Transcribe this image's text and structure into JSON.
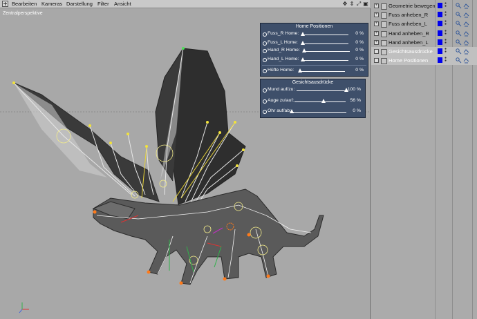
{
  "menubar": {
    "items": [
      "Bearbeiten",
      "Kameras",
      "Darstellung",
      "Filter",
      "Ansicht"
    ]
  },
  "nav_icons": [
    "move-view-icon",
    "scroll-view-icon",
    "zoom-view-icon",
    "rotate-view-icon"
  ],
  "viewport": {
    "camera_label": "Zentralperspektive"
  },
  "home_panel": {
    "title": "Home Positionen",
    "sliders": [
      {
        "label": "Fuss_R Home:",
        "value": "0 %",
        "level": 0
      },
      {
        "label": "Fuss_L Home:",
        "value": "0 %",
        "level": 0
      },
      {
        "label": "Hand_R Home:",
        "value": "0 %",
        "level": 0
      },
      {
        "label": "Hand_L Home:",
        "value": "0 %",
        "level": 0
      },
      {
        "label": "Hüfte Home:",
        "value": "0 %",
        "level": 0
      }
    ]
  },
  "face_panel": {
    "title": "Gesichtsausdrücke",
    "sliders": [
      {
        "label": "Mund auf/zu:",
        "value": "100 %",
        "level": 1.0
      },
      {
        "label": "Auge zu/auf:",
        "value": "56 %",
        "level": 0.56
      },
      {
        "label": "Ohr auf/ab:",
        "value": "0 %",
        "level": 0
      }
    ]
  },
  "objects": [
    {
      "name": "Geometrie bewegen",
      "expand": "+",
      "color": "#0000ee",
      "selected": false
    },
    {
      "name": "Fuss anheben_R",
      "expand": "+",
      "color": "#0000ee",
      "selected": false
    },
    {
      "name": "Fuss anheben_L",
      "expand": "+",
      "color": "#0000ee",
      "selected": false
    },
    {
      "name": "Hand anheben_R",
      "expand": "+",
      "color": "#0000ee",
      "selected": false
    },
    {
      "name": "Hand anheben_L",
      "expand": "+",
      "color": "#0000ee",
      "selected": false
    },
    {
      "name": "Gesichtsausdrücke",
      "expand": "",
      "color": "#0000ee",
      "selected": true
    },
    {
      "name": "Home Positionen",
      "expand": "",
      "color": "#0000ee",
      "selected": true
    }
  ],
  "colors": {
    "panel_bg": "#3e4f6a",
    "swatch_blue": "#0000ee",
    "selection": "#c0c0c0"
  }
}
